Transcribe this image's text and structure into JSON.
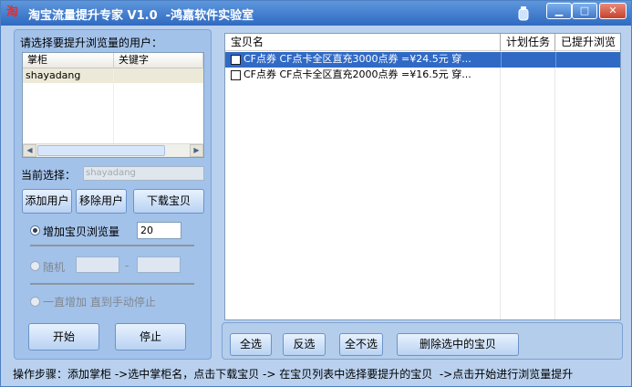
{
  "window": {
    "title": "淘宝流量提升专家 V1.0  -鸿嘉软件实验室",
    "icon": "app-logo-icon",
    "controls": [
      "minimize-icon",
      "maximize-icon",
      "close-icon"
    ]
  },
  "left": {
    "prompt": "请选择要提升浏览量的用户：",
    "user_list": {
      "columns": [
        "掌柜",
        "关键字"
      ],
      "rows": [
        [
          "shayadang",
          ""
        ]
      ]
    },
    "current_label": "当前选择：",
    "current_value": "shayadang",
    "buttons": {
      "add_user": "添加用户",
      "remove_user": "移除用户",
      "download": "下载宝贝"
    },
    "option_increase": "增加宝贝浏览量",
    "increase_count": "20",
    "option_random": "随机",
    "random_dash": "-",
    "option_continuous": "一直增加 直到手动停止",
    "start": "开始",
    "stop": "停止"
  },
  "items": {
    "columns": [
      "宝贝名",
      "计划任务",
      "已提升浏览"
    ],
    "rows": [
      {
        "name": "CF点券 CF点卡全区直充3000点券 =¥24.5元 穿...",
        "plan": "",
        "done": "",
        "selected": true
      },
      {
        "name": "CF点券 CF点卡全区直充2000点券 =¥16.5元 穿...",
        "plan": "",
        "done": "",
        "selected": false
      }
    ]
  },
  "actions": {
    "select_all": "全选",
    "invert": "反选",
    "select_none": "全不选",
    "delete_selected": "删除选中的宝贝"
  },
  "status": "操作步骤：添加掌柜 ->选中掌柜名，点击下载宝贝 -> 在宝贝列表中选择要提升的宝贝  ->点击开始进行浏览量提升",
  "colors": {
    "titlebar": "#3a74c8",
    "selection": "#316ac5",
    "panel": "#a3c2ea"
  }
}
